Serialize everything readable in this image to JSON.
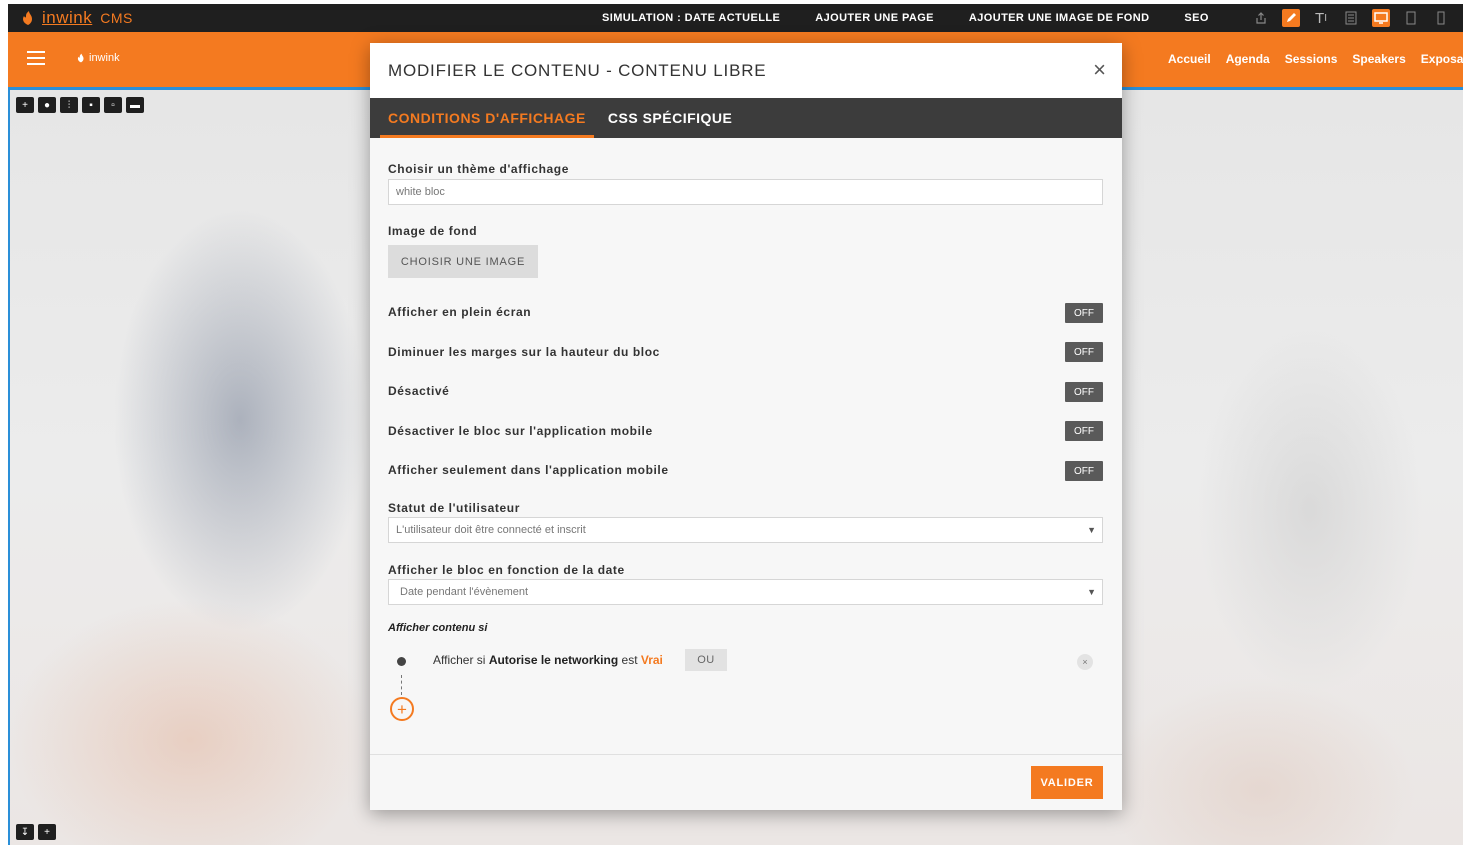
{
  "cms_bar": {
    "brand": "inwink",
    "cms_label": "CMS",
    "nav": [
      "SIMULATION : DATE ACTUELLE",
      "AJOUTER UNE PAGE",
      "AJOUTER UNE IMAGE DE FOND",
      "SEO"
    ],
    "icons": [
      "share-icon",
      "edit-icon",
      "text-icon",
      "layout-icon",
      "desktop-icon",
      "tablet-icon",
      "mobile-icon"
    ]
  },
  "site": {
    "logo": "inwink",
    "menu": [
      "Accueil",
      "Agenda",
      "Sessions",
      "Speakers",
      "Exposan"
    ]
  },
  "modal": {
    "title": "MODIFIER LE CONTENU - CONTENU LIBRE",
    "close": "×",
    "tabs": [
      "CONDITIONS D'AFFICHAGE",
      "CSS SPÉCIFIQUE"
    ],
    "theme_label": "Choisir un thème d'affichage",
    "theme_value": "white bloc",
    "bg_label": "Image de fond",
    "bg_button": "CHOISIR UNE IMAGE",
    "toggles": [
      {
        "label": "Afficher en plein écran",
        "state": "OFF"
      },
      {
        "label": "Diminuer les marges sur la hauteur du bloc",
        "state": "OFF"
      },
      {
        "label": "Désactivé",
        "state": "OFF"
      },
      {
        "label": "Désactiver le bloc sur l'application mobile",
        "state": "OFF"
      },
      {
        "label": "Afficher seulement dans l'application mobile",
        "state": "OFF"
      }
    ],
    "user_status_label": "Statut de l'utilisateur",
    "user_status_value": "L'utilisateur doit être connecté et inscrit",
    "date_label": "Afficher le bloc en fonction de la date",
    "date_value": "Date pendant l'évènement",
    "cond_title": "Afficher contenu si",
    "condition": {
      "prefix": "Afficher si",
      "field": "Autorise le networking",
      "middle": "est",
      "value": "Vrai",
      "or_button": "OU",
      "remove": "×"
    },
    "add": "+",
    "validate": "VALIDER"
  },
  "colors": {
    "accent": "#f47a20",
    "dark": "#1f1f1f",
    "tabs_bg": "#3c3c3c",
    "toggle_off": "#5a5a5a"
  }
}
